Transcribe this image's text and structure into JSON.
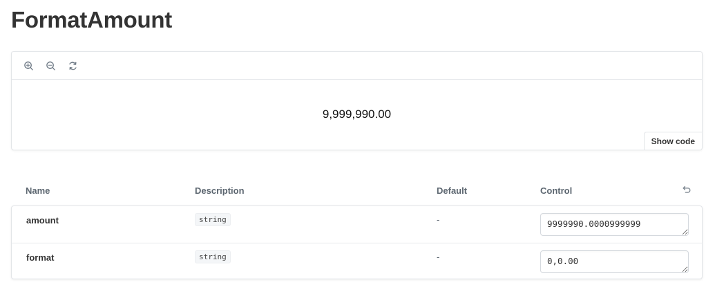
{
  "page": {
    "title": "FormatAmount"
  },
  "preview": {
    "toolbar": {
      "icons": [
        "zoom-in-icon",
        "zoom-out-icon",
        "reset-zoom-icon"
      ]
    },
    "rendered_value": "9,999,990.00",
    "show_code_label": "Show code"
  },
  "args_table": {
    "headers": {
      "name": "Name",
      "description": "Description",
      "default": "Default",
      "control": "Control"
    },
    "rows": [
      {
        "name": "amount",
        "type": "string",
        "default": "-",
        "control_value": "9999990.0000999999"
      },
      {
        "name": "format",
        "type": "string",
        "default": "-",
        "control_value": "0,0.00"
      }
    ]
  },
  "colors": {
    "text": "#333333",
    "border": "#e2e5e8",
    "muted": "#5c6670"
  }
}
